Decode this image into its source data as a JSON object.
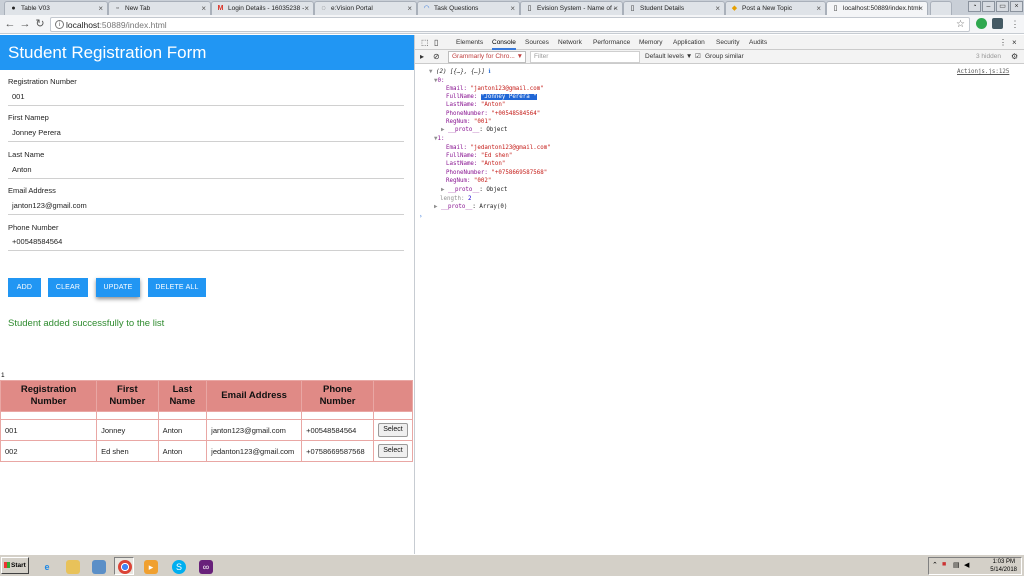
{
  "browser": {
    "tabs": [
      {
        "title": "Table V03",
        "icon": "github-icon"
      },
      {
        "title": "New Tab",
        "icon": "blank-page-icon"
      },
      {
        "title": "Login Details - 16035238 -",
        "icon": "gmail-icon"
      },
      {
        "title": "e:Vision Portal",
        "icon": "globe-icon"
      },
      {
        "title": "Task Questions",
        "icon": "loading-icon"
      },
      {
        "title": "Evision System - Name of -",
        "icon": "page-icon"
      },
      {
        "title": "Student Details",
        "icon": "page-icon"
      },
      {
        "title": "Post a New Topic",
        "icon": "forum-icon"
      },
      {
        "title": "localhost:50889/index.html",
        "icon": "page-icon",
        "active": true
      }
    ],
    "url_host": "localhost",
    "url_path": ":50889/index.html"
  },
  "form": {
    "title": "Student Registration Form",
    "fields": [
      {
        "label": "Registration Number",
        "value": "001"
      },
      {
        "label": "First Namep",
        "value": "Jonney Perera"
      },
      {
        "label": "Last Name",
        "value": "Anton"
      },
      {
        "label": "Email Address",
        "value": "janton123@gmail.com"
      },
      {
        "label": "Phone Number",
        "value": "+00548584564"
      }
    ],
    "buttons": {
      "add": "ADD",
      "clear": "CLEAR",
      "update": "UPDATE",
      "delete_all": "DELETE ALL"
    },
    "accent_color": "#2196f3",
    "status_message": "Student added successfully to the list",
    "stray_text": "1"
  },
  "table": {
    "headers": [
      {
        "line1": "Registration",
        "line2": "Number"
      },
      {
        "line1": "First",
        "line2": "Number"
      },
      {
        "line1": "Last",
        "line2": "Name"
      },
      {
        "line1": "Email Address",
        "line2": ""
      },
      {
        "line1": "Phone",
        "line2": "Number"
      },
      {
        "line1": "",
        "line2": ""
      }
    ],
    "header_color": "#e08a86",
    "rows": [
      {
        "reg": "001",
        "first": "Jonney",
        "last": "Anton",
        "email": "janton123@gmail.com",
        "phone": "+00548584564",
        "action": "Select"
      },
      {
        "reg": "002",
        "first": "Ed shen",
        "last": "Anton",
        "email": "jedanton123@gmail.com",
        "phone": "+0758669587568",
        "action": "Select"
      }
    ]
  },
  "devtools": {
    "tabs": [
      "Elements",
      "Console",
      "Sources",
      "Network",
      "Performance",
      "Memory",
      "Application",
      "Security",
      "Audits"
    ],
    "active_tab": "Console",
    "context": "Grammarly for Chro...",
    "filter_placeholder": "Filter",
    "default_levels": "Default levels ▼",
    "group_similar": "Group similar",
    "hidden_count": "3 hidden",
    "source_link": "Actionjs.js:125",
    "log": {
      "summary": "(2) [{…}, {…}]",
      "item0_index": "0:",
      "item0": {
        "Email": "\"janton123@gmail.com\"",
        "FullName": "\"Jonney Perera \"",
        "LastName": "\"Anton\"",
        "PhoneNumber": "\"+00548584564\"",
        "RegNum": "\"001\"",
        "proto": "Object"
      },
      "item1_index": "1:",
      "item1": {
        "Email": "\"jedanton123@gmail.com\"",
        "FullName": "\"Ed shen\"",
        "LastName": "\"Anton\"",
        "PhoneNumber": "\"+0758669587568\"",
        "RegNum": "\"002\"",
        "proto": "Object"
      },
      "length_label": "length:",
      "length_value": "2",
      "array_proto": "Array(0)"
    }
  },
  "taskbar": {
    "start_label": "Start",
    "time": "1:03 PM",
    "date": "5/14/2018"
  }
}
